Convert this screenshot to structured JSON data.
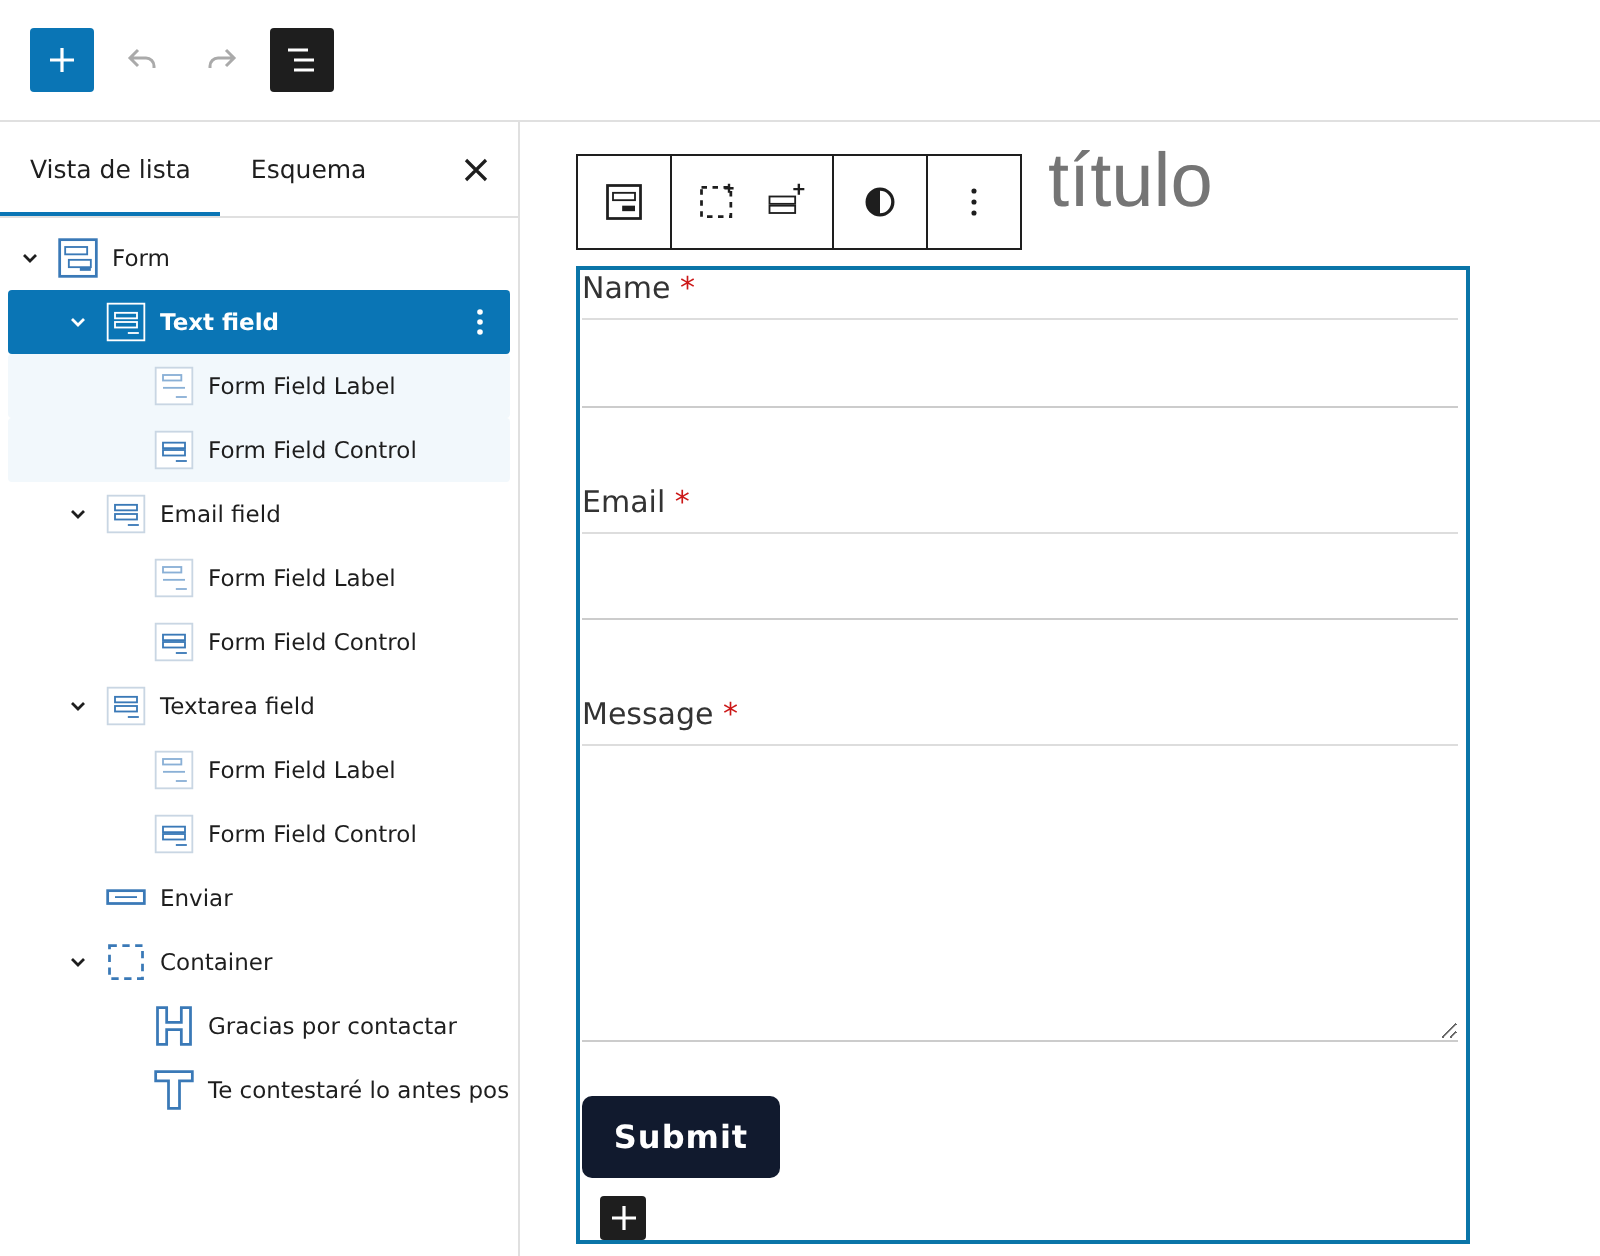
{
  "tabs": [
    {
      "label": "Vista de lista",
      "selected": true
    },
    {
      "label": "Esquema",
      "selected": false
    }
  ],
  "tree": [
    {
      "label": "Form",
      "kind": "form",
      "selected": false,
      "expanded": true,
      "children": [
        {
          "label": "Text field",
          "kind": "field",
          "selected": true,
          "expanded": true,
          "children": [
            {
              "label": "Form Field Label",
              "kind": "label",
              "selected": false
            },
            {
              "label": "Form Field Control",
              "kind": "control",
              "selected": false
            }
          ]
        },
        {
          "label": "Email field",
          "kind": "field",
          "selected": false,
          "expanded": true,
          "children": [
            {
              "label": "Form Field Label",
              "kind": "label",
              "selected": false
            },
            {
              "label": "Form Field Control",
              "kind": "control",
              "selected": false
            }
          ]
        },
        {
          "label": "Textarea field",
          "kind": "field",
          "selected": false,
          "expanded": true,
          "children": [
            {
              "label": "Form Field Label",
              "kind": "label",
              "selected": false
            },
            {
              "label": "Form Field Control",
              "kind": "control",
              "selected": false
            }
          ]
        },
        {
          "label": "Enviar",
          "kind": "button",
          "selected": false
        },
        {
          "label": "Container",
          "kind": "group",
          "selected": false,
          "expanded": true,
          "children": [
            {
              "label": "Gracias por contactar",
              "kind": "heading",
              "selected": false
            },
            {
              "label": "Te contestaré lo antes pos",
              "kind": "paragraph",
              "selected": false
            }
          ]
        }
      ]
    }
  ],
  "canvas": {
    "heading": "título",
    "fields": [
      {
        "label": "Name",
        "required_mark": "*",
        "kind": "input"
      },
      {
        "label": "Email",
        "required_mark": "*",
        "kind": "input"
      },
      {
        "label": "Message",
        "required_mark": "*",
        "kind": "textarea"
      }
    ],
    "submit": "Submit"
  }
}
